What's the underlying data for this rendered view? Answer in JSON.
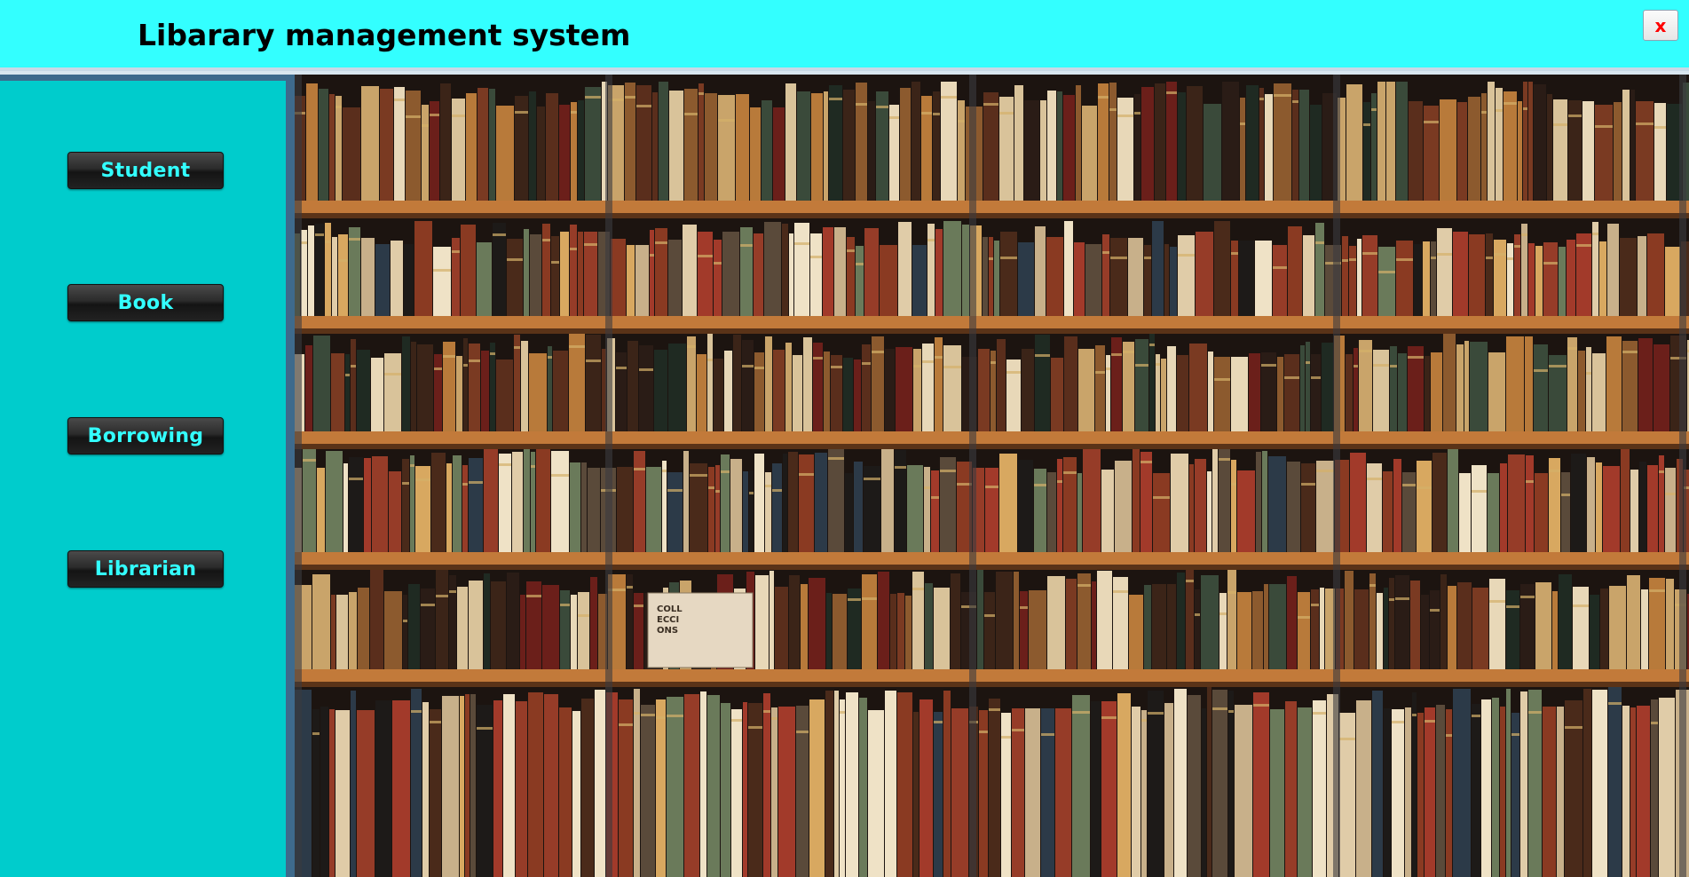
{
  "window": {
    "title": "Libarary management system",
    "close_label": "x"
  },
  "sidebar": {
    "items": [
      {
        "label": "Student"
      },
      {
        "label": "Book"
      },
      {
        "label": "Borrowing"
      },
      {
        "label": "Librarian"
      }
    ]
  },
  "hero_image": {
    "subject": "bookshelf-photo",
    "box_label_lines": [
      "COLL",
      "ECCI",
      "ONS"
    ]
  },
  "colors": {
    "titlebar": "#33ffff",
    "sidebar": "#00cccc",
    "sidebar_border": "#3e6a8c",
    "button_text": "#33ffff",
    "close_x": "#ff0000"
  }
}
